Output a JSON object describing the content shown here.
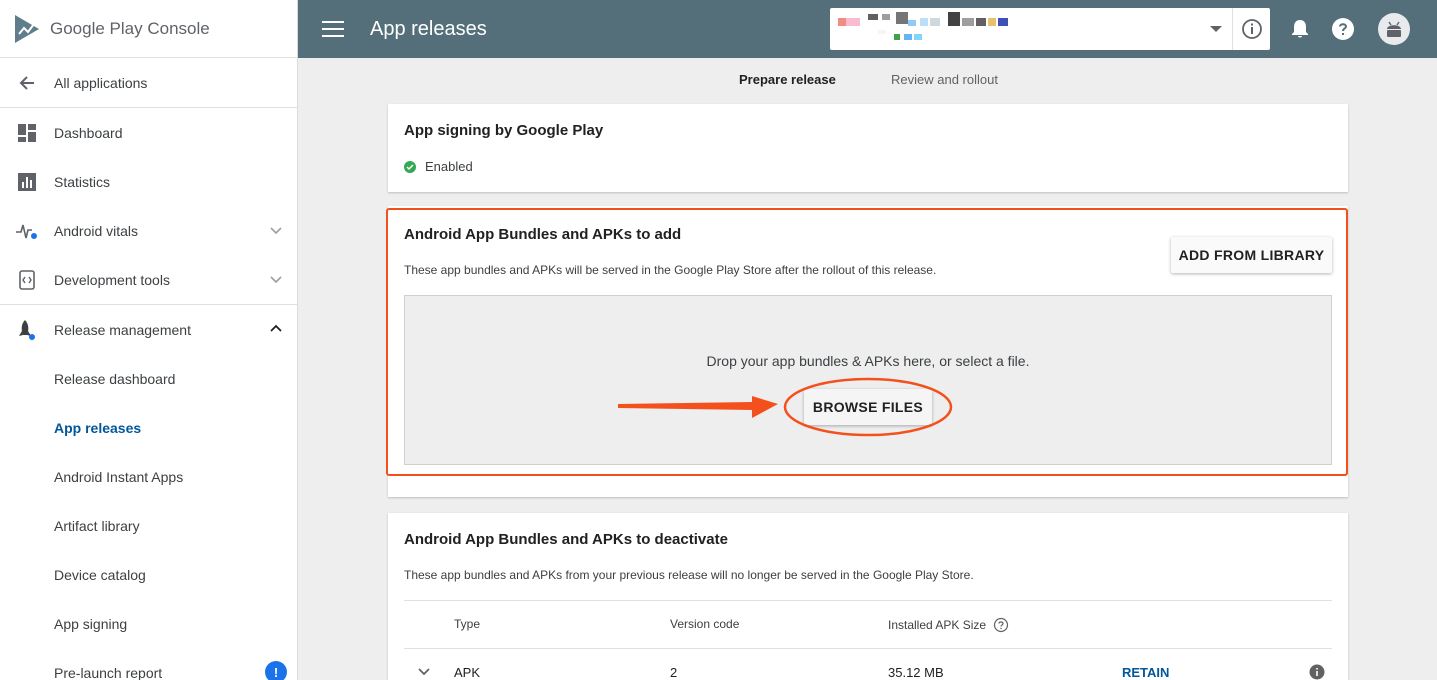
{
  "brand": {
    "name": "Google Play Console"
  },
  "sidebar": {
    "back": {
      "label": "All applications",
      "icon": "arrow-left-icon"
    },
    "items": [
      {
        "label": "Dashboard",
        "icon": "dashboard-icon"
      },
      {
        "label": "Statistics",
        "icon": "bar-chart-icon"
      },
      {
        "label": "Android vitals",
        "icon": "vitals-icon",
        "expandable": true
      },
      {
        "label": "Development tools",
        "icon": "code-icon",
        "expandable": true
      },
      {
        "label": "Release management",
        "icon": "rocket-icon",
        "expanded": true
      }
    ],
    "subitems": [
      {
        "label": "Release dashboard"
      },
      {
        "label": "App releases",
        "active": true
      },
      {
        "label": "Android Instant Apps"
      },
      {
        "label": "Artifact library"
      },
      {
        "label": "Device catalog"
      },
      {
        "label": "App signing"
      },
      {
        "label": "Pre-launch report",
        "badge": "!"
      }
    ]
  },
  "topbar": {
    "title": "App releases",
    "app_selector": ""
  },
  "steps": [
    {
      "label": "Prepare release",
      "active": true
    },
    {
      "label": "Review and rollout"
    }
  ],
  "signing": {
    "title": "App signing by Google Play",
    "status": "Enabled"
  },
  "add": {
    "title": "Android App Bundles and APKs to add",
    "description": "These app bundles and APKs will be served in the Google Play Store after the rollout of this release.",
    "library_button": "ADD FROM LIBRARY",
    "drop_text": "Drop your app bundles & APKs here, or select a file.",
    "browse_button": "BROWSE FILES"
  },
  "deactivate": {
    "title": "Android App Bundles and APKs to deactivate",
    "description": "These app bundles and APKs from your previous release will no longer be served in the Google Play Store.",
    "columns": [
      "Type",
      "Version code",
      "Installed APK Size"
    ],
    "rows": [
      {
        "type": "APK",
        "version_code": "2",
        "size": "35.12 MB",
        "action": "RETAIN"
      }
    ]
  },
  "colors": {
    "topbar": "#546e7a",
    "active_link": "#01579b",
    "annotation": "#f4501e",
    "enabled": "#34a853"
  }
}
